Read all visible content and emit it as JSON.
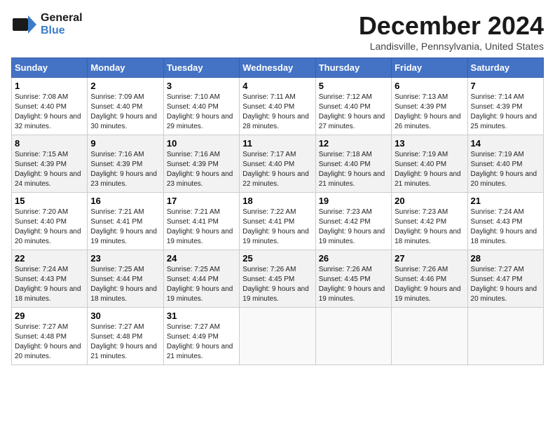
{
  "logo": {
    "line1": "General",
    "line2": "Blue"
  },
  "title": "December 2024",
  "subtitle": "Landisville, Pennsylvania, United States",
  "days_of_week": [
    "Sunday",
    "Monday",
    "Tuesday",
    "Wednesday",
    "Thursday",
    "Friday",
    "Saturday"
  ],
  "weeks": [
    [
      {
        "day": "1",
        "sunrise": "7:08 AM",
        "sunset": "4:40 PM",
        "daylight": "9 hours and 32 minutes."
      },
      {
        "day": "2",
        "sunrise": "7:09 AM",
        "sunset": "4:40 PM",
        "daylight": "9 hours and 30 minutes."
      },
      {
        "day": "3",
        "sunrise": "7:10 AM",
        "sunset": "4:40 PM",
        "daylight": "9 hours and 29 minutes."
      },
      {
        "day": "4",
        "sunrise": "7:11 AM",
        "sunset": "4:40 PM",
        "daylight": "9 hours and 28 minutes."
      },
      {
        "day": "5",
        "sunrise": "7:12 AM",
        "sunset": "4:40 PM",
        "daylight": "9 hours and 27 minutes."
      },
      {
        "day": "6",
        "sunrise": "7:13 AM",
        "sunset": "4:39 PM",
        "daylight": "9 hours and 26 minutes."
      },
      {
        "day": "7",
        "sunrise": "7:14 AM",
        "sunset": "4:39 PM",
        "daylight": "9 hours and 25 minutes."
      }
    ],
    [
      {
        "day": "8",
        "sunrise": "7:15 AM",
        "sunset": "4:39 PM",
        "daylight": "9 hours and 24 minutes."
      },
      {
        "day": "9",
        "sunrise": "7:16 AM",
        "sunset": "4:39 PM",
        "daylight": "9 hours and 23 minutes."
      },
      {
        "day": "10",
        "sunrise": "7:16 AM",
        "sunset": "4:39 PM",
        "daylight": "9 hours and 23 minutes."
      },
      {
        "day": "11",
        "sunrise": "7:17 AM",
        "sunset": "4:40 PM",
        "daylight": "9 hours and 22 minutes."
      },
      {
        "day": "12",
        "sunrise": "7:18 AM",
        "sunset": "4:40 PM",
        "daylight": "9 hours and 21 minutes."
      },
      {
        "day": "13",
        "sunrise": "7:19 AM",
        "sunset": "4:40 PM",
        "daylight": "9 hours and 21 minutes."
      },
      {
        "day": "14",
        "sunrise": "7:19 AM",
        "sunset": "4:40 PM",
        "daylight": "9 hours and 20 minutes."
      }
    ],
    [
      {
        "day": "15",
        "sunrise": "7:20 AM",
        "sunset": "4:40 PM",
        "daylight": "9 hours and 20 minutes."
      },
      {
        "day": "16",
        "sunrise": "7:21 AM",
        "sunset": "4:41 PM",
        "daylight": "9 hours and 19 minutes."
      },
      {
        "day": "17",
        "sunrise": "7:21 AM",
        "sunset": "4:41 PM",
        "daylight": "9 hours and 19 minutes."
      },
      {
        "day": "18",
        "sunrise": "7:22 AM",
        "sunset": "4:41 PM",
        "daylight": "9 hours and 19 minutes."
      },
      {
        "day": "19",
        "sunrise": "7:23 AM",
        "sunset": "4:42 PM",
        "daylight": "9 hours and 19 minutes."
      },
      {
        "day": "20",
        "sunrise": "7:23 AM",
        "sunset": "4:42 PM",
        "daylight": "9 hours and 18 minutes."
      },
      {
        "day": "21",
        "sunrise": "7:24 AM",
        "sunset": "4:43 PM",
        "daylight": "9 hours and 18 minutes."
      }
    ],
    [
      {
        "day": "22",
        "sunrise": "7:24 AM",
        "sunset": "4:43 PM",
        "daylight": "9 hours and 18 minutes."
      },
      {
        "day": "23",
        "sunrise": "7:25 AM",
        "sunset": "4:44 PM",
        "daylight": "9 hours and 18 minutes."
      },
      {
        "day": "24",
        "sunrise": "7:25 AM",
        "sunset": "4:44 PM",
        "daylight": "9 hours and 19 minutes."
      },
      {
        "day": "25",
        "sunrise": "7:26 AM",
        "sunset": "4:45 PM",
        "daylight": "9 hours and 19 minutes."
      },
      {
        "day": "26",
        "sunrise": "7:26 AM",
        "sunset": "4:45 PM",
        "daylight": "9 hours and 19 minutes."
      },
      {
        "day": "27",
        "sunrise": "7:26 AM",
        "sunset": "4:46 PM",
        "daylight": "9 hours and 19 minutes."
      },
      {
        "day": "28",
        "sunrise": "7:27 AM",
        "sunset": "4:47 PM",
        "daylight": "9 hours and 20 minutes."
      }
    ],
    [
      {
        "day": "29",
        "sunrise": "7:27 AM",
        "sunset": "4:48 PM",
        "daylight": "9 hours and 20 minutes."
      },
      {
        "day": "30",
        "sunrise": "7:27 AM",
        "sunset": "4:48 PM",
        "daylight": "9 hours and 21 minutes."
      },
      {
        "day": "31",
        "sunrise": "7:27 AM",
        "sunset": "4:49 PM",
        "daylight": "9 hours and 21 minutes."
      },
      null,
      null,
      null,
      null
    ]
  ]
}
